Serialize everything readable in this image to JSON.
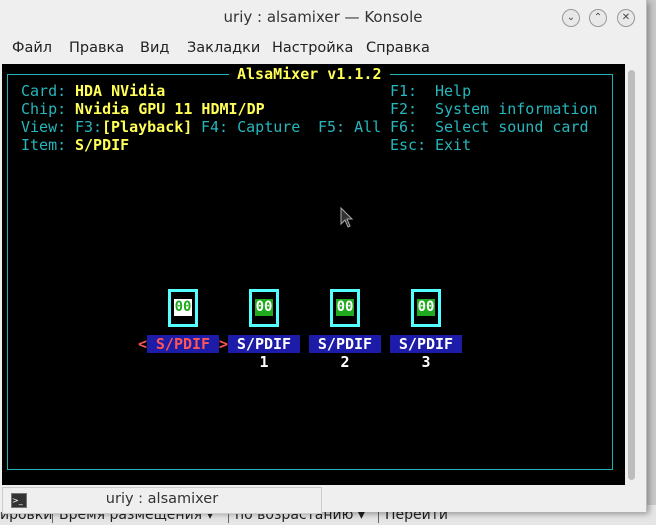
{
  "window": {
    "title": "uriy : alsamixer — Konsole",
    "buttons": [
      "minimize",
      "maximize",
      "close"
    ]
  },
  "menu": [
    "Файл",
    "Правка",
    "Вид",
    "Закладки",
    "Настройка",
    "Справка"
  ],
  "mixer": {
    "title": "AlsaMixer v1.1.2",
    "card_label": "Card:",
    "card": "HDA NVidia",
    "chip_label": "Chip:",
    "chip": "Nvidia GPU 11 HDMI/DP",
    "view_label": "View:",
    "view_f3": "F3:",
    "view_playback": "[Playback]",
    "view_f4": "F4: Capture",
    "view_f5": "F5: All",
    "item_label": "Item:",
    "item": "S/PDIF",
    "keys": [
      {
        "key": "F1:",
        "desc": "Help"
      },
      {
        "key": "F2:",
        "desc": "System information"
      },
      {
        "key": "F6:",
        "desc": "Select sound card"
      },
      {
        "key": "Esc:",
        "desc": "Exit"
      }
    ],
    "controls": [
      {
        "name": "S/PDIF",
        "value": "00",
        "selected": true
      },
      {
        "name": "S/PDIF 1",
        "value": "00"
      },
      {
        "name": "S/PDIF 2",
        "value": "00"
      },
      {
        "name": "S/PDIF 3",
        "value": "00"
      }
    ],
    "sel_left": "<",
    "sel_right": ">"
  },
  "tab": {
    "label": "uriy : alsamixer"
  },
  "background": [
    "ировки",
    "Время размещения ▾",
    "по возрастанию ▾",
    "Перейти"
  ]
}
